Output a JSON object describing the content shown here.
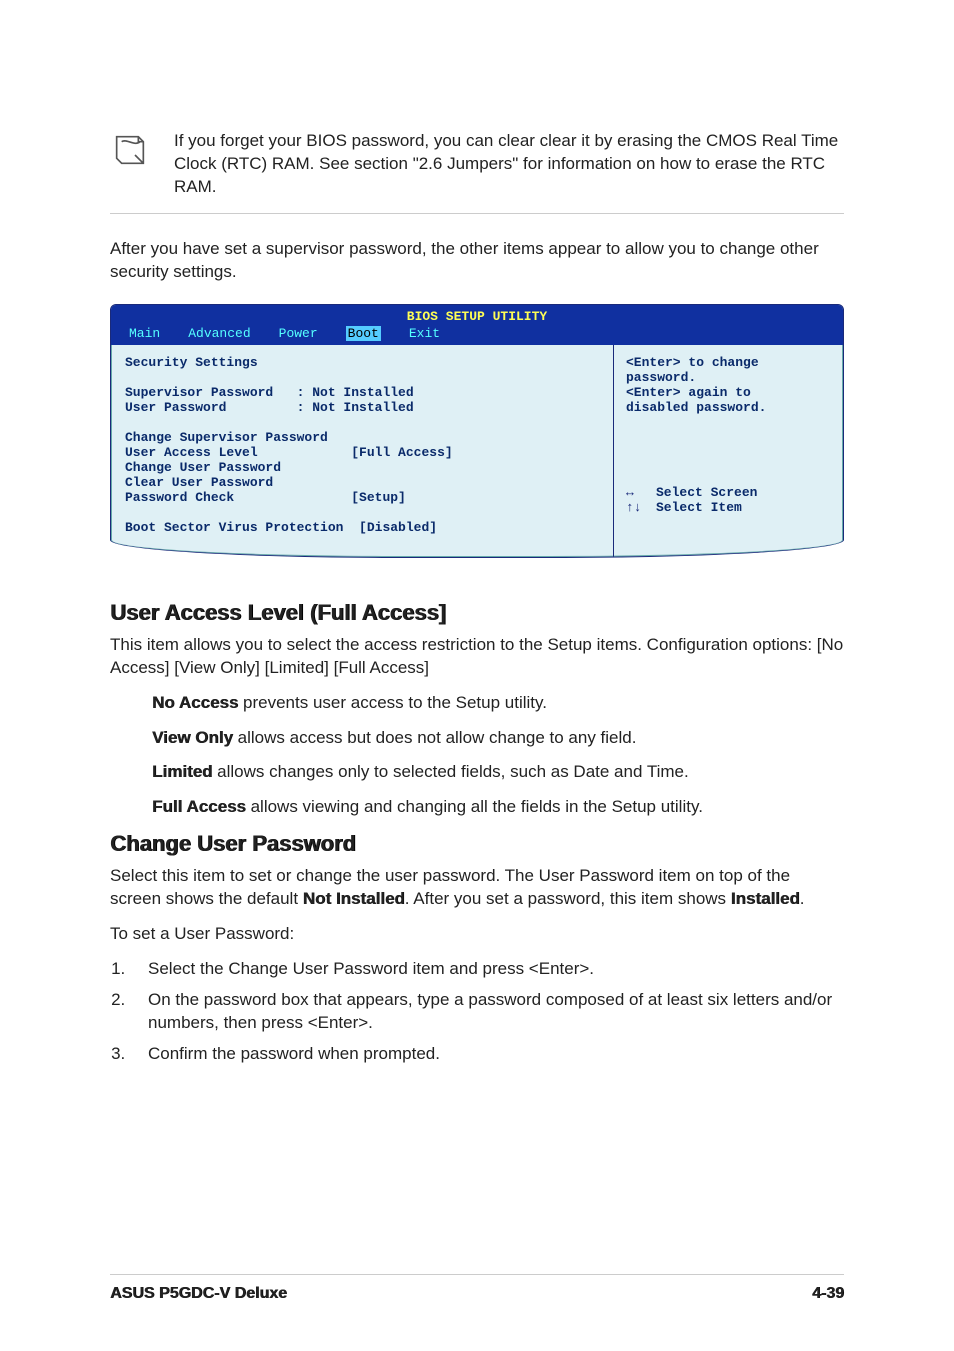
{
  "note": {
    "text": "If you forget your BIOS password, you can clear clear it by erasing the CMOS Real Time Clock (RTC) RAM. See section \"2.6  Jumpers\" for information on how to erase the RTC RAM."
  },
  "intro": "After you have set a supervisor password, the other items appear to allow you to change other security settings.",
  "bios": {
    "title": "BIOS SETUP UTILITY",
    "tabs": [
      "Main",
      "Advanced",
      "Power",
      "Boot",
      "Exit"
    ],
    "activeTabIndex": 3,
    "sectionHeader": "Security Settings",
    "status": [
      "Supervisor Password   : Not Installed",
      "User Password         : Not Installed"
    ],
    "items": [
      {
        "label": "Change Supervisor Password",
        "value": ""
      },
      {
        "label": "User Access Level",
        "value": "[Full Access]"
      },
      {
        "label": "Change User Password",
        "value": ""
      },
      {
        "label": "Clear User Password",
        "value": ""
      },
      {
        "label": "Password Check",
        "value": "[Setup]"
      }
    ],
    "extra": {
      "label": "Boot Sector Virus Protection",
      "value": "[Disabled]"
    },
    "help": {
      "l1": "<Enter> to change",
      "l2": "password.",
      "l3": "<Enter> again to",
      "l4": "disabled password."
    },
    "nav": {
      "a1": "↔",
      "t1": "Select Screen",
      "a2": "↑↓",
      "t2": "Select Item"
    }
  },
  "section1": {
    "heading": "User Access Level (Full Access]",
    "p1": "This item allows you to select the access restriction to the Setup items. Configuration options: [No Access] [View Only] [Limited] [Full Access]",
    "defs": [
      {
        "term": "No Access",
        "desc": " prevents user access to the Setup utility."
      },
      {
        "term": "View Only",
        "desc": " allows access but does not allow change to any field."
      },
      {
        "term": "Limited",
        "desc": " allows changes only to selected fields, such as Date and Time."
      },
      {
        "term": "Full Access",
        "desc": " allows viewing and changing all the fields in the Setup utility."
      }
    ]
  },
  "section2": {
    "heading": "Change User Password",
    "p1a": "Select this item to set or change the user password. The User Password item on top of the screen shows the default ",
    "p1b": "Not Installed",
    "p1c": ". After you set a password, this item shows ",
    "p1d": "Installed",
    "p1e": ".",
    "p2": "To set a User Password:",
    "steps": [
      "Select the Change User Password item and press <Enter>.",
      "On the password box that appears, type a password composed of at least six letters and/or numbers, then press <Enter>.",
      "Confirm the password when prompted."
    ]
  },
  "footer": {
    "left": "ASUS P5GDC-V Deluxe",
    "right": "4-39"
  }
}
